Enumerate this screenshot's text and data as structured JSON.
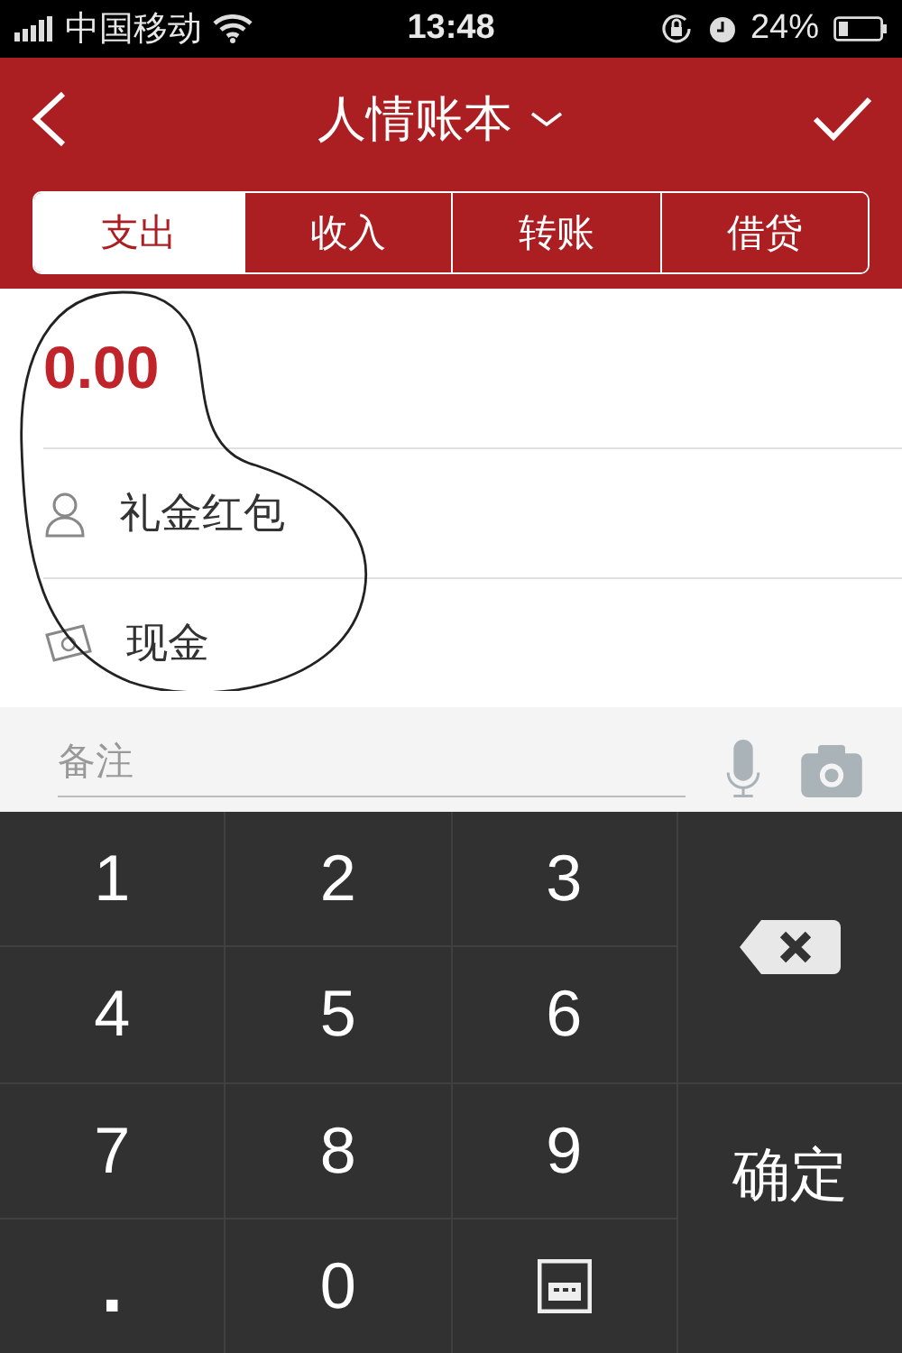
{
  "status_bar": {
    "carrier": "中国移动",
    "time": "13:48",
    "battery": "24%"
  },
  "header": {
    "title": "人情账本"
  },
  "tabs": [
    {
      "label": "支出",
      "selected": true
    },
    {
      "label": "收入",
      "selected": false
    },
    {
      "label": "转账",
      "selected": false
    },
    {
      "label": "借贷",
      "selected": false
    }
  ],
  "amount": "0.00",
  "category": "礼金红包",
  "account": "现金",
  "note": {
    "placeholder": "备注"
  },
  "keypad": [
    {
      "kind": "digit",
      "label": "1"
    },
    {
      "kind": "digit",
      "label": "2"
    },
    {
      "kind": "digit",
      "label": "3"
    },
    {
      "kind": "backspace"
    },
    {
      "kind": "digit",
      "label": "4"
    },
    {
      "kind": "digit",
      "label": "5"
    },
    {
      "kind": "digit",
      "label": "6"
    },
    {
      "kind": "digit",
      "label": "7"
    },
    {
      "kind": "digit",
      "label": "8"
    },
    {
      "kind": "digit",
      "label": "9"
    },
    {
      "kind": "confirm",
      "label": "确定"
    },
    {
      "kind": "digit",
      "label": "."
    },
    {
      "kind": "digit",
      "label": "0"
    },
    {
      "kind": "hide"
    }
  ]
}
